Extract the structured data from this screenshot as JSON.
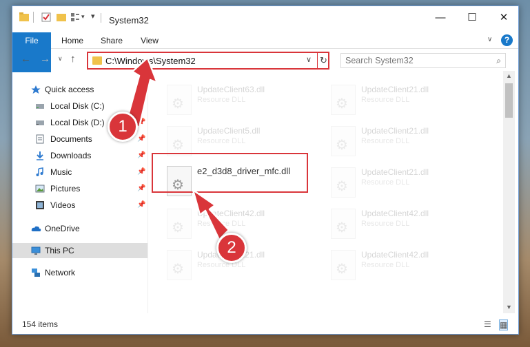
{
  "window": {
    "title": "System32",
    "controls": {
      "minimize": "—",
      "maximize": "☐",
      "close": "✕"
    }
  },
  "ribbon": {
    "tabs": [
      "File",
      "Home",
      "Share",
      "View"
    ],
    "help": "?"
  },
  "navbar": {
    "address": "C:\\Windows\\System32",
    "search_placeholder": "Search System32"
  },
  "sidebar": {
    "items": [
      {
        "label": "Quick access",
        "icon": "star-icon",
        "pinned": false,
        "selected": false
      },
      {
        "label": "Local Disk (C:)",
        "icon": "drive-icon",
        "pinned": true,
        "selected": false
      },
      {
        "label": "Local Disk (D:)",
        "icon": "drive-icon",
        "pinned": true,
        "selected": false
      },
      {
        "label": "Documents",
        "icon": "documents-icon",
        "pinned": true,
        "selected": false
      },
      {
        "label": "Downloads",
        "icon": "download-icon",
        "pinned": true,
        "selected": false
      },
      {
        "label": "Music",
        "icon": "music-icon",
        "pinned": true,
        "selected": false
      },
      {
        "label": "Pictures",
        "icon": "pictures-icon",
        "pinned": true,
        "selected": false
      },
      {
        "label": "Videos",
        "icon": "videos-icon",
        "pinned": true,
        "selected": false
      },
      {
        "label": "OneDrive",
        "icon": "cloud-icon",
        "pinned": false,
        "selected": false
      },
      {
        "label": "This PC",
        "icon": "pc-icon",
        "pinned": false,
        "selected": true
      },
      {
        "label": "Network",
        "icon": "network-icon",
        "pinned": false,
        "selected": false
      }
    ]
  },
  "files": [
    {
      "name": "UpdateClient63.dll",
      "type": "Resource DLL",
      "faded": true
    },
    {
      "name": "UpdateClient21.dll",
      "type": "Resource DLL",
      "faded": true
    },
    {
      "name": "UpdateClient5.dll",
      "type": "Resource DLL",
      "faded": true
    },
    {
      "name": "UpdateClient21.dll",
      "type": "Resource DLL",
      "faded": true
    },
    {
      "name": "e2_d3d8_driver_mfc.dll",
      "type": "",
      "faded": false
    },
    {
      "name": "UpdateClient21.dll",
      "type": "Resource DLL",
      "faded": true
    },
    {
      "name": "UpdateClient42.dll",
      "type": "Resource DLL",
      "faded": true
    },
    {
      "name": "UpdateClient42.dll",
      "type": "Resource DLL",
      "faded": true
    },
    {
      "name": "UpdateClient21.dll",
      "type": "Resource DLL",
      "faded": true
    },
    {
      "name": "UpdateClient42.dll",
      "type": "Resource DLL",
      "faded": true
    }
  ],
  "status": {
    "item_count": "154 items"
  },
  "annotations": {
    "step1": "1",
    "step2": "2",
    "color": "#d9353a"
  },
  "colors": {
    "accent": "#1979ca",
    "folder": "#f0c24b",
    "highlight": "#d9353a"
  }
}
